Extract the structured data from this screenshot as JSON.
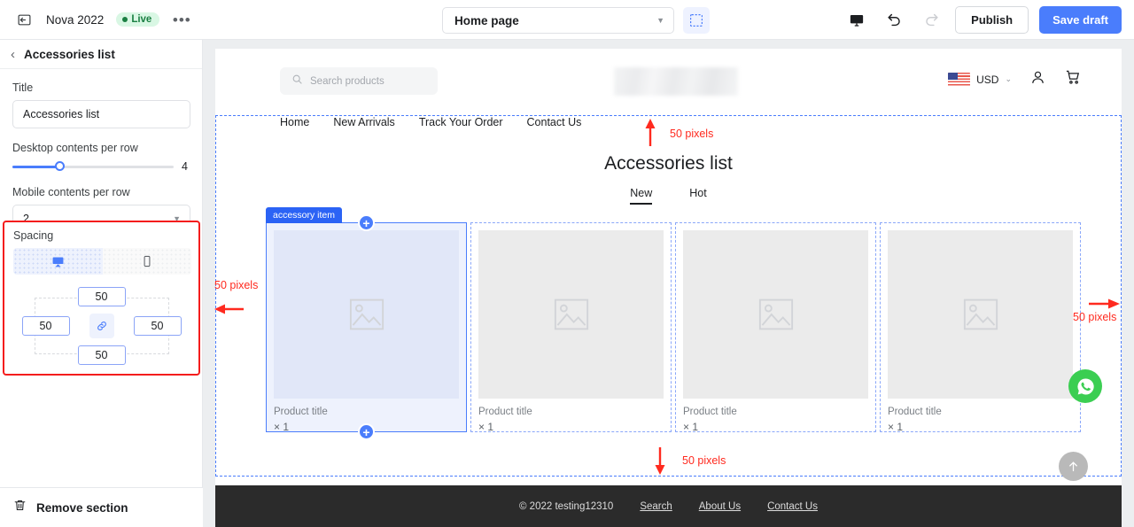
{
  "topbar": {
    "back_icon": "back-arrow-icon",
    "project_name": "Nova 2022",
    "live_label": "Live",
    "more_label": "•••",
    "page_select_value": "Home page",
    "select_tool_icon": "select-area-icon",
    "preview_icon": "desktop-preview-icon",
    "undo_icon": "undo-icon",
    "redo_icon": "redo-icon",
    "publish_label": "Publish",
    "save_draft_label": "Save draft"
  },
  "sidebar": {
    "back_icon": "chevron-left-icon",
    "panel_title": "Accessories list",
    "title_label": "Title",
    "title_value": "Accessories list",
    "desktop_label": "Desktop contents per row",
    "desktop_value": "4",
    "mobile_label": "Mobile contents per row",
    "mobile_value": "2",
    "spacing_label": "Spacing",
    "device_desktop_icon": "desktop-icon",
    "device_mobile_icon": "mobile-icon",
    "spacing_top": "50",
    "spacing_left": "50",
    "spacing_right": "50",
    "spacing_bottom": "50",
    "link_icon": "link-chain-icon",
    "remove_icon": "trash-icon",
    "remove_label": "Remove section",
    "highlight_color": "#f41d1d"
  },
  "canvas": {
    "store": {
      "search_placeholder": "Search products",
      "search_icon": "search-icon",
      "logo": "store-logo-placeholder",
      "flag_icon": "us-flag-icon",
      "currency": "USD",
      "currency_caret": "chevron-down-icon",
      "account_icon": "user-account-icon",
      "cart_icon": "shopping-cart-icon",
      "nav": [
        "Home",
        "New Arrivals",
        "Track Your Order",
        "Contact Us"
      ]
    },
    "section": {
      "heading": "Accessories list",
      "tabs": [
        {
          "label": "New",
          "active": true
        },
        {
          "label": "Hot",
          "active": false
        }
      ],
      "item_tag": "accessory item",
      "products": [
        {
          "title": "Product title",
          "qty": "× 1",
          "selected": true
        },
        {
          "title": "Product title",
          "qty": "× 1",
          "selected": false
        },
        {
          "title": "Product title",
          "qty": "× 1",
          "selected": false
        },
        {
          "title": "Product title",
          "qty": "× 1",
          "selected": false
        }
      ]
    },
    "annotations": {
      "top": "50 pixels",
      "left": "50 pixels",
      "right": "50 pixels",
      "bottom": "50 pixels",
      "color": "#ff2a1f"
    },
    "widgets": {
      "whatsapp_icon": "whatsapp-icon",
      "scroll_top_icon": "arrow-up-icon"
    },
    "footer": {
      "copyright": "© 2022 testing12310",
      "links": [
        "Search",
        "About Us",
        "Contact Us"
      ]
    }
  }
}
